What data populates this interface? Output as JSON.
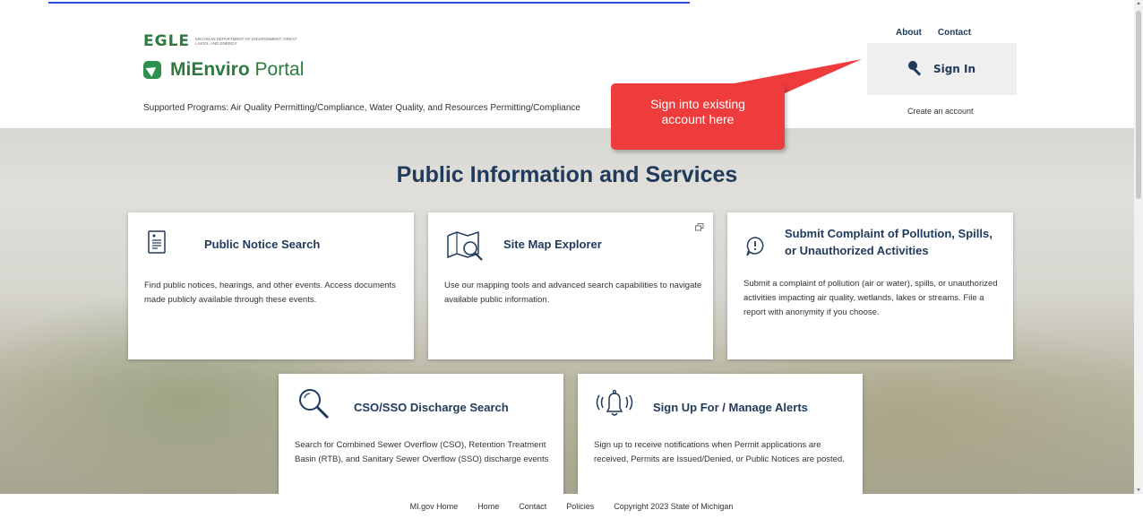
{
  "header": {
    "egle_wordmark": "EGLE",
    "egle_subtitle": "Michigan Department of Environment, Great Lakes, and Energy",
    "portal_name_bold": "MiEnviro",
    "portal_name_rest": " Portal",
    "supported_programs": "Supported Programs: Air Quality Permitting/Compliance, Water Quality, and Resources Permitting/Compliance"
  },
  "top_nav": {
    "about": "About",
    "contact": "Contact",
    "sign_in": "Sign In",
    "create_account": "Create an account"
  },
  "callout": {
    "line1": "Sign into existing",
    "line2": "account here",
    "color": "#ee3b3b"
  },
  "main": {
    "title": "Public Information and Services",
    "cards": [
      {
        "title": "Public Notice Search",
        "text": "Find public notices, hearings, and other events. Access documents made publicly available through these events.",
        "icon": "document-list-icon"
      },
      {
        "title": "Site Map Explorer",
        "text": "Use our mapping tools and advanced search capabilities to navigate available public information.",
        "icon": "map-search-icon"
      },
      {
        "title_line1": "Submit Complaint of Pollution, Spills,",
        "title_line2": "or Unauthorized Activities",
        "text": "Submit a complaint of pollution (air or water), spills, or unauthorized activities impacting air quality, wetlands, lakes or streams. File a report with anonymity if you choose.",
        "icon": "exclamation-bubble-icon"
      },
      {
        "title": "CSO/SSO Discharge Search",
        "text": "Search for Combined Sewer Overflow (CSO), Retention Treatment Basin (RTB), and Sanitary Sewer Overflow (SSO) discharge events",
        "icon": "magnifier-icon"
      },
      {
        "title": "Sign Up For / Manage Alerts",
        "text": "Sign up to receive notifications when Permit applications are received, Permits are Issued/Denied, or Public Notices are posted.",
        "icon": "bell-icon"
      }
    ]
  },
  "footer": {
    "mi_gov_home": "MI.gov Home",
    "home": "Home",
    "contact": "Contact",
    "policies": "Policies",
    "copyright": "Copyright 2023 State of Michigan"
  },
  "colors": {
    "brand_green": "#2f7a3f",
    "navy": "#1f3a5a",
    "link_blue": "#2b4fd8"
  }
}
